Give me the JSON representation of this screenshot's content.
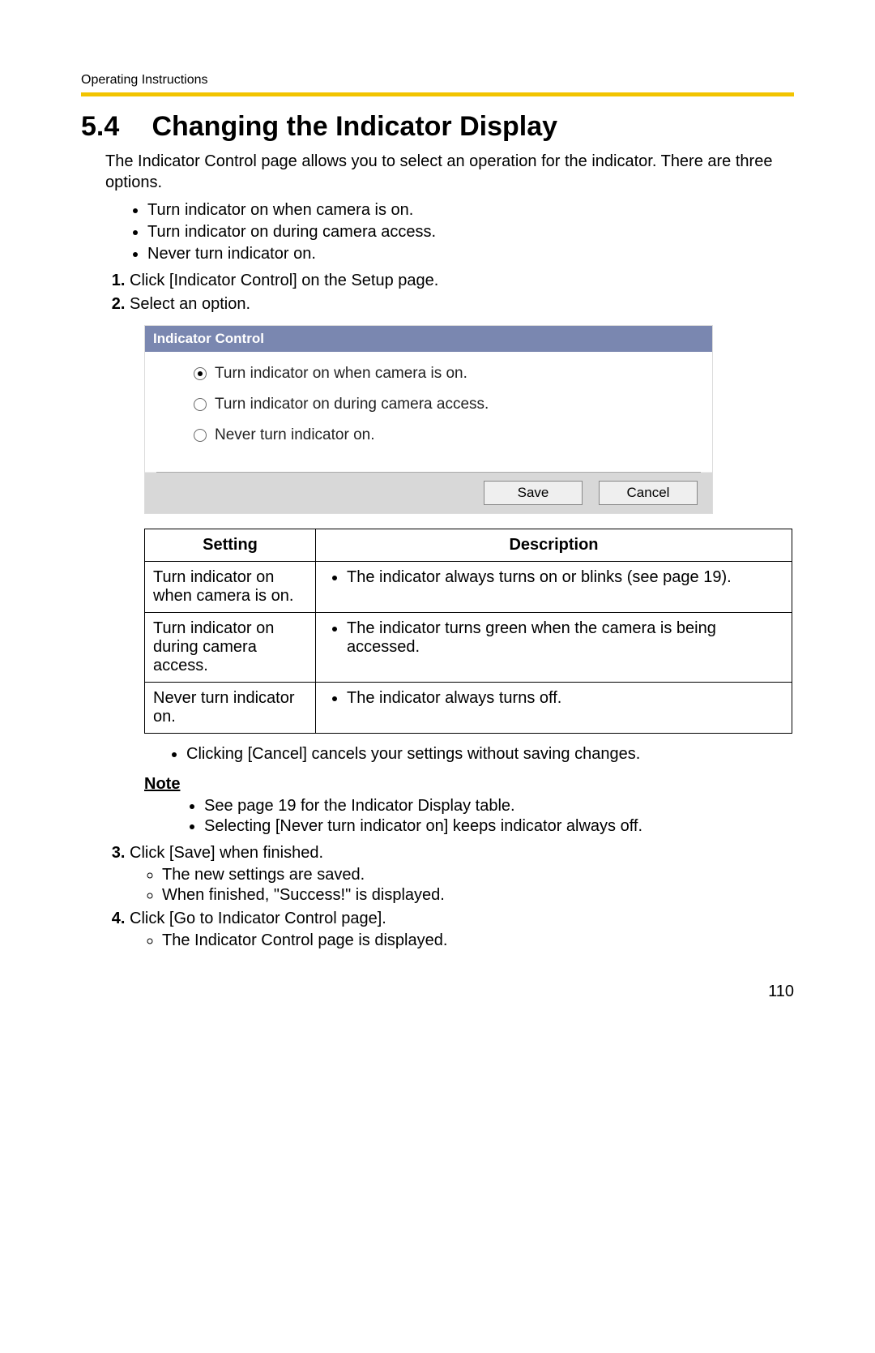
{
  "header": {
    "running": "Operating Instructions"
  },
  "section": {
    "number": "5.4",
    "title": "Changing the Indicator Display"
  },
  "intro": "The Indicator Control page allows you to select an operation for the indicator. There are three options.",
  "options": [
    "Turn indicator on when camera is on.",
    "Turn indicator on during camera access.",
    "Never turn indicator on."
  ],
  "steps": {
    "s1": "Click [Indicator Control] on the Setup page.",
    "s2": "Select an option.",
    "s3": "Click [Save] when finished.",
    "s3_sub": [
      "The new settings are saved.",
      "When finished, \"Success!\" is displayed."
    ],
    "s4": "Click [Go to Indicator Control page].",
    "s4_sub": [
      "The Indicator Control page is displayed."
    ]
  },
  "ui": {
    "title": "Indicator Control",
    "radios": [
      {
        "label": "Turn indicator on when camera is on.",
        "selected": true
      },
      {
        "label": "Turn indicator on during camera access.",
        "selected": false
      },
      {
        "label": "Never turn indicator on.",
        "selected": false
      }
    ],
    "save": "Save",
    "cancel": "Cancel"
  },
  "table": {
    "head_setting": "Setting",
    "head_desc": "Description",
    "rows": [
      {
        "setting": "Turn indicator on when camera is on.",
        "desc": "The indicator always turns on or blinks (see page 19)."
      },
      {
        "setting": "Turn indicator on during camera access.",
        "desc": "The indicator turns green when the camera is being accessed."
      },
      {
        "setting": "Never turn indicator on.",
        "desc": "The indicator always turns off."
      }
    ]
  },
  "after_table_bullet": "Clicking [Cancel] cancels your settings without saving changes.",
  "note": {
    "heading": "Note",
    "items": [
      "See page 19 for the Indicator Display table.",
      "Selecting [Never turn indicator on] keeps indicator always off."
    ]
  },
  "page_number": "110"
}
